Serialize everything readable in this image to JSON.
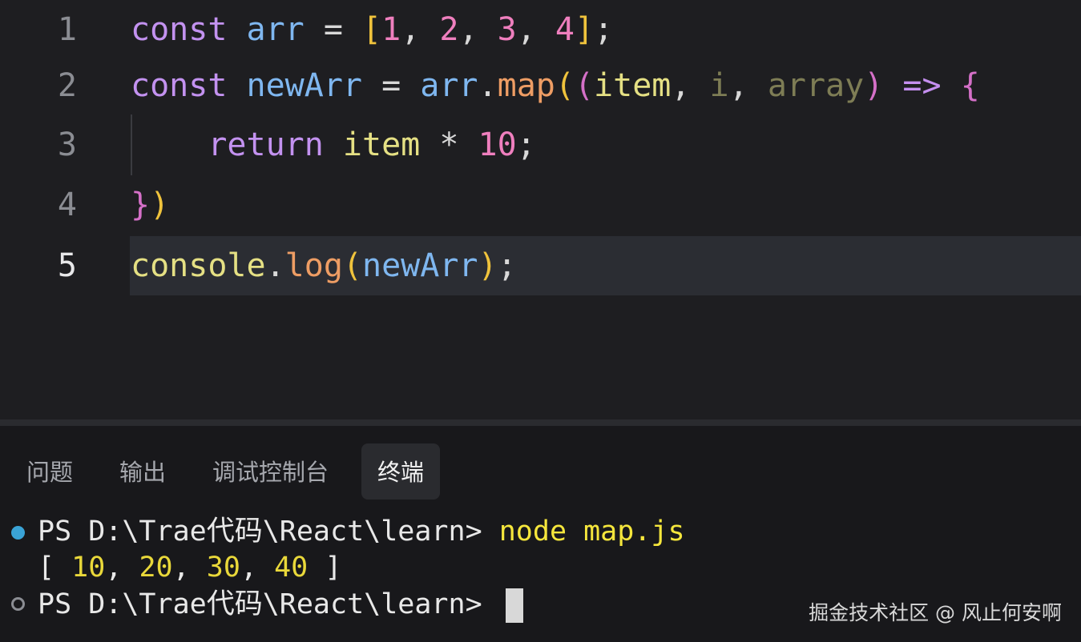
{
  "editor": {
    "line_numbers": [
      "1",
      "2",
      "3",
      "4",
      "5"
    ],
    "current_line": 5,
    "lines": [
      [
        {
          "t": "const",
          "c": "k"
        },
        {
          "t": " "
        },
        {
          "t": "arr",
          "c": "v"
        },
        {
          "t": " = ",
          "c": "p"
        },
        {
          "t": "[",
          "c": "b1"
        },
        {
          "t": "1",
          "c": "n"
        },
        {
          "t": ", ",
          "c": "p"
        },
        {
          "t": "2",
          "c": "n"
        },
        {
          "t": ", ",
          "c": "p"
        },
        {
          "t": "3",
          "c": "n"
        },
        {
          "t": ", ",
          "c": "p"
        },
        {
          "t": "4",
          "c": "n"
        },
        {
          "t": "]",
          "c": "b1"
        },
        {
          "t": ";",
          "c": "p"
        }
      ],
      [
        {
          "t": "const",
          "c": "k"
        },
        {
          "t": " "
        },
        {
          "t": "newArr",
          "c": "v"
        },
        {
          "t": " = ",
          "c": "p"
        },
        {
          "t": "arr",
          "c": "v"
        },
        {
          "t": ".",
          "c": "p"
        },
        {
          "t": "map",
          "c": "f"
        },
        {
          "t": "(",
          "c": "b1"
        },
        {
          "t": "(",
          "c": "b2"
        },
        {
          "t": "item",
          "c": "id"
        },
        {
          "t": ", ",
          "c": "p"
        },
        {
          "t": "i",
          "c": "dim"
        },
        {
          "t": ", ",
          "c": "p"
        },
        {
          "t": "array",
          "c": "dim"
        },
        {
          "t": ")",
          "c": "b2"
        },
        {
          "t": " ",
          "c": "p"
        },
        {
          "t": "=>",
          "c": "a"
        },
        {
          "t": " ",
          "c": "p"
        },
        {
          "t": "{",
          "c": "b2"
        }
      ],
      [
        {
          "t": "    "
        },
        {
          "t": "return",
          "c": "k"
        },
        {
          "t": " "
        },
        {
          "t": "item",
          "c": "id"
        },
        {
          "t": " * ",
          "c": "p"
        },
        {
          "t": "10",
          "c": "n"
        },
        {
          "t": ";",
          "c": "p"
        }
      ],
      [
        {
          "t": "}",
          "c": "b2"
        },
        {
          "t": ")",
          "c": "b1"
        }
      ],
      [
        {
          "t": "console",
          "c": "id"
        },
        {
          "t": ".",
          "c": "p"
        },
        {
          "t": "log",
          "c": "f"
        },
        {
          "t": "(",
          "c": "b1"
        },
        {
          "t": "newArr",
          "c": "v"
        },
        {
          "t": ")",
          "c": "b1"
        },
        {
          "t": ";",
          "c": "p"
        }
      ]
    ]
  },
  "panel": {
    "tabs": [
      "问题",
      "输出",
      "调试控制台",
      "终端"
    ],
    "active_tab": "终端"
  },
  "terminal": {
    "line1_prompt": "PS D:\\Trae代码\\React\\learn> ",
    "line1_command": "node map.js",
    "output_open": "[ ",
    "output_values": [
      10,
      20,
      30,
      40
    ],
    "output_close": " ]",
    "line3_prompt": "PS D:\\Trae代码\\React\\learn> "
  },
  "watermark": "掘金技术社区 @ 风止何安啊",
  "colors": {
    "keyword": "#c392f0",
    "variable": "#7fb7f0",
    "number": "#ef7fbe",
    "function": "#ee9d64",
    "bracket_outer": "#f0c33c",
    "bracket_inner": "#d570c8",
    "terminal_command": "#f5e63c",
    "status_dot": "#3aa3d6"
  }
}
